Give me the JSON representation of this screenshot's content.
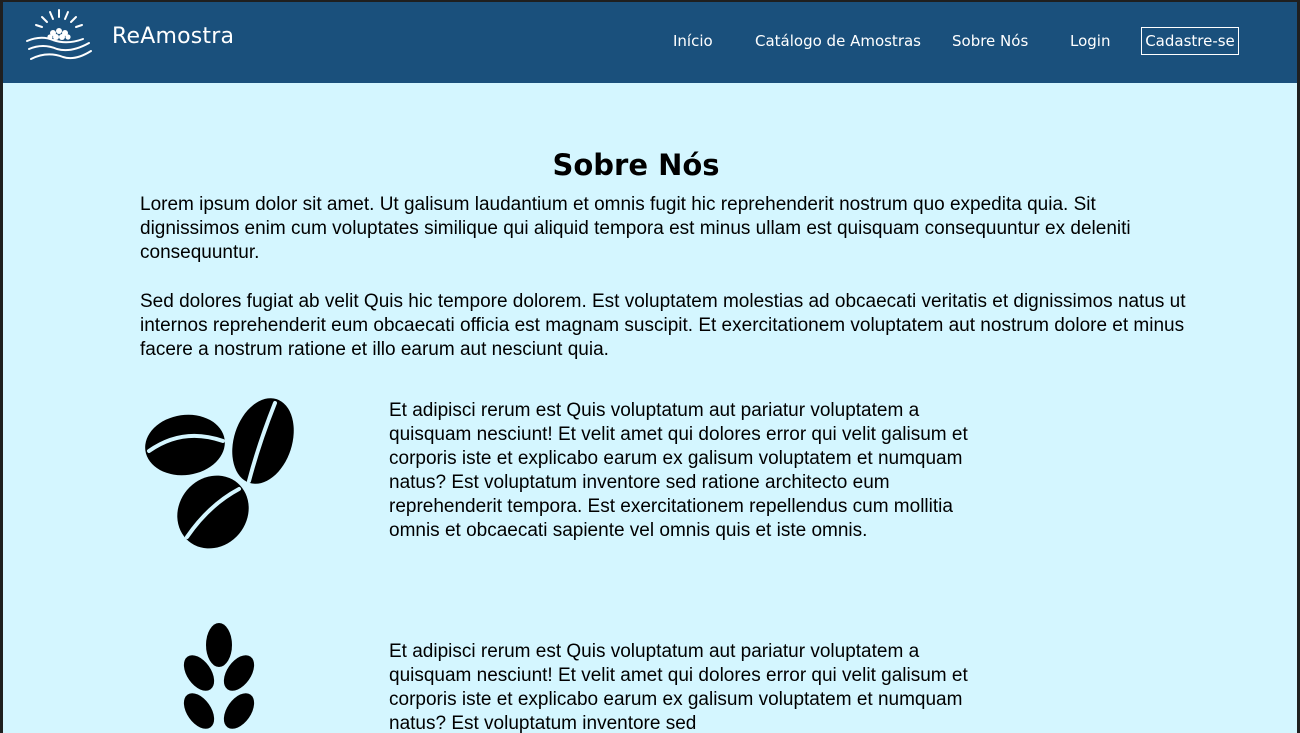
{
  "header": {
    "brand": "ReAmostra",
    "logo_icon": "sun-hand-grains-icon",
    "nav": {
      "inicio": "Início",
      "catalogo": "Catálogo de Amostras",
      "sobre": "Sobre Nós",
      "login": "Login",
      "cadastro": "Cadastre-se"
    }
  },
  "main": {
    "title": "Sobre Nós",
    "paragraphs": [
      "Lorem ipsum dolor sit amet. Ut galisum laudantium et omnis fugit hic reprehenderit nostrum quo expedita quia. Sit dignissimos enim cum voluptates similique qui aliquid tempora est minus ullam est quisquam consequuntur ex deleniti consequuntur.",
      "Sed dolores fugiat ab velit Quis hic tempore dolorem. Est voluptatem molestias ad obcaecati veritatis et dignissimos natus ut internos reprehenderit eum obcaecati officia est magnam suscipit. Et exercitationem voluptatem aut nostrum dolore et minus facere a nostrum ratione et illo earum aut nesciunt quia."
    ],
    "features": [
      {
        "icon": "coffee-beans-icon",
        "text": "Et adipisci rerum est Quis voluptatum aut pariatur voluptatem a quisquam nesciunt! Et velit amet qui dolores error qui velit galisum et corporis iste et explicabo earum ex galisum voluptatem et numquam natus? Est voluptatum inventore sed ratione architecto eum reprehenderit tempora. Est exercitationem repellendus cum mollitia omnis et obcaecati sapiente vel omnis quis et iste omnis."
      },
      {
        "icon": "wheat-icon",
        "text": "Et adipisci rerum est Quis voluptatum aut pariatur voluptatem a quisquam nesciunt! Et velit amet qui dolores error qui velit galisum et corporis iste et explicabo earum ex galisum voluptatem et numquam natus? Est voluptatum inventore sed"
      }
    ]
  },
  "colors": {
    "header_bg": "#1a507c",
    "page_bg": "#d4f6ff"
  }
}
